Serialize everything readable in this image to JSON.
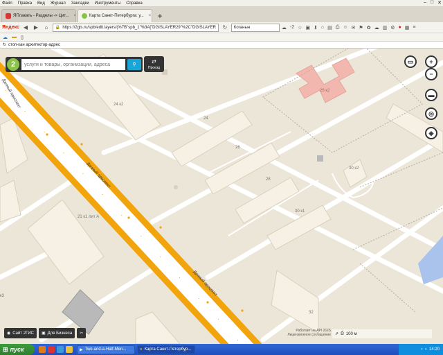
{
  "menubar": {
    "items": [
      "Файл",
      "Правка",
      "Вид",
      "Журнал",
      "Закладки",
      "Инструменты",
      "Справка"
    ]
  },
  "tabs": [
    {
      "label": "ЯПлакать - Разделы -> Цит...",
      "color": "#d33"
    },
    {
      "label": "Карта Санкт-Петербурга: у...",
      "color": "#8bc34a"
    }
  ],
  "navbar": {
    "brand": "Яндекс",
    "url": "https://2gis.ru/spb/edit.layers/(%7B\"spb_1\"%3A[\"DGISLAYER29\"%2C\"DGISLAYER",
    "search_value": "Коганын",
    "counter": "-2"
  },
  "findbar": {
    "text": "стоп-кан архитектор-адрес"
  },
  "search": {
    "placeholder": "услуги и товары, организации, адреса"
  },
  "route_label": "Проезд",
  "map": {
    "streets": [
      {
        "name": "Дачный проспект"
      },
      {
        "name": "Дачный проспект"
      },
      {
        "name": "Дачный проспект"
      }
    ],
    "buildings": [
      "24 к2",
      "24",
      "26",
      "28",
      "30 к1",
      "30 к2",
      "26 к2",
      "21 к1 лит А",
      "32",
      "к3"
    ]
  },
  "bottom_buttons": [
    "Сайт 2ГИС",
    "Для Бизнеса"
  ],
  "copyright": {
    "line1": "Работает на API 2GIS",
    "line2": "Лицензионное соглашение"
  },
  "scale": {
    "label": "100 м"
  },
  "taskbar": {
    "start": "пуск",
    "tasks": [
      "Two-and-a-Half-Men...",
      "Карта Санкт-Петербур..."
    ],
    "clock": "14:20"
  },
  "colors": {
    "avenue": "#f2a40c",
    "building_pink": "#f2b8b0",
    "building": "#f6f1e4",
    "water": "#a9c3ec"
  }
}
